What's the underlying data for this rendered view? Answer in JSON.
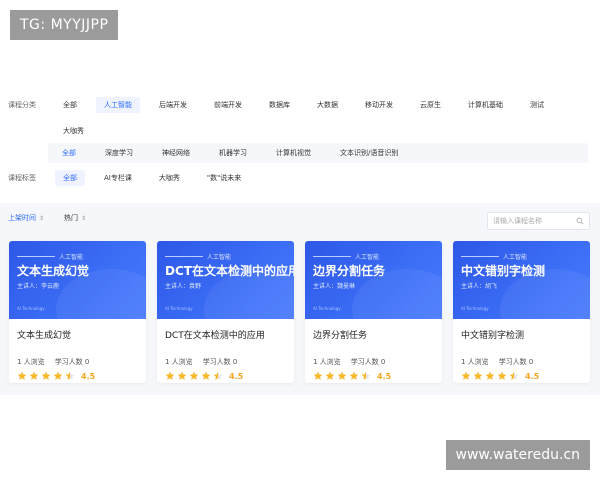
{
  "badges": {
    "tg": "TG: MYYJJPP",
    "watermark": "www.wateredu.cn"
  },
  "filters": {
    "category_label": "课程分类",
    "categories": [
      "全部",
      "人工智能",
      "后端开发",
      "前端开发",
      "数据库",
      "大数据",
      "移动开发",
      "云原生",
      "计算机基础",
      "测试",
      "大咖秀"
    ],
    "subcategories": [
      "全部",
      "深度学习",
      "神经网络",
      "机器学习",
      "计算机视觉",
      "文本识别/语音识别"
    ],
    "tag_label": "课程标签",
    "tags": [
      "全部",
      "AI专栏课",
      "大咖秀",
      "\"数\"说未来"
    ]
  },
  "sort": {
    "time": "上架时间",
    "hot": "热门"
  },
  "search": {
    "placeholder": "请输入课程名称"
  },
  "cards": [
    {
      "category": "人工智能",
      "cover_title": "文本生成幻觉",
      "speaker": "主讲人：李云鹿",
      "brand": "AI Technology",
      "name": "文本生成幻觉",
      "views": "1 人浏览",
      "learners": "学习人数 0",
      "rating": 4.5,
      "score": "4.5"
    },
    {
      "category": "人工智能",
      "cover_title": "DCT在文本检测中的应用",
      "speaker": "主讲人：袁野",
      "brand": "AI Technology",
      "name": "DCT在文本检测中的应用",
      "views": "1 人浏览",
      "learners": "学习人数 0",
      "rating": 4.5,
      "score": "4.5"
    },
    {
      "category": "人工智能",
      "cover_title": "边界分割任务",
      "speaker": "主讲人：魏曼琳",
      "brand": "AI Technology",
      "name": "边界分割任务",
      "views": "1 人浏览",
      "learners": "学习人数 0",
      "rating": 4.5,
      "score": "4.5"
    },
    {
      "category": "人工智能",
      "cover_title": "中文错别字检测",
      "speaker": "主讲人：胡飞",
      "brand": "AI Technology",
      "name": "中文错别字检测",
      "views": "1 人浏览",
      "learners": "学习人数 0",
      "rating": 4.5,
      "score": "4.5"
    }
  ],
  "colors": {
    "accent": "#2f6bff",
    "star": "#f5b82e",
    "cover": "#3a6cf4"
  },
  "icons": {
    "search": "search-icon",
    "star": "star-icon",
    "sort": "sort-arrows-icon"
  }
}
